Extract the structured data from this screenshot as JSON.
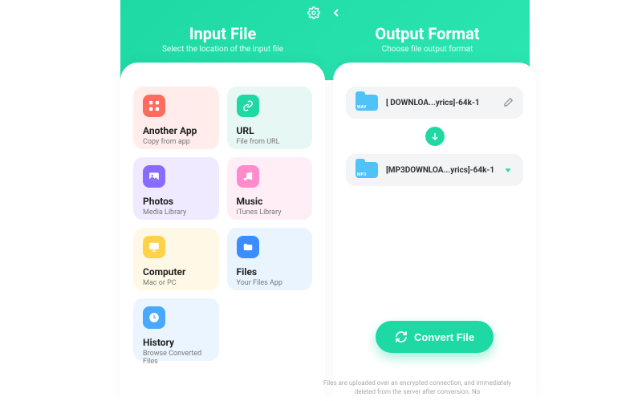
{
  "header": {
    "input_title": "Input File",
    "input_sub": "Select the location of the input file",
    "output_title": "Output Format",
    "output_sub": "Choose file output format"
  },
  "tiles": {
    "app": {
      "title": "Another App",
      "sub": "Copy from app"
    },
    "url": {
      "title": "URL",
      "sub": "File from URL"
    },
    "photos": {
      "title": "Photos",
      "sub": "Media Library"
    },
    "music": {
      "title": "Music",
      "sub": "iTunes Library"
    },
    "comp": {
      "title": "Computer",
      "sub": "Mac or PC"
    },
    "files": {
      "title": "Files",
      "sub": "Your Files App"
    },
    "hist": {
      "title": "History",
      "sub": "Browse Converted Files"
    }
  },
  "source_file": {
    "format": "WAV",
    "name": "[ DOWNLOA...yrics]-64k-1"
  },
  "target_file": {
    "format": "MP3",
    "name": "[MP3DOWNLOA...yrics]-64k-1"
  },
  "convert_button": "Convert File",
  "footer": "Files are uploaded over an encrypted connection, and immediately deleted from the server after conversion. No"
}
